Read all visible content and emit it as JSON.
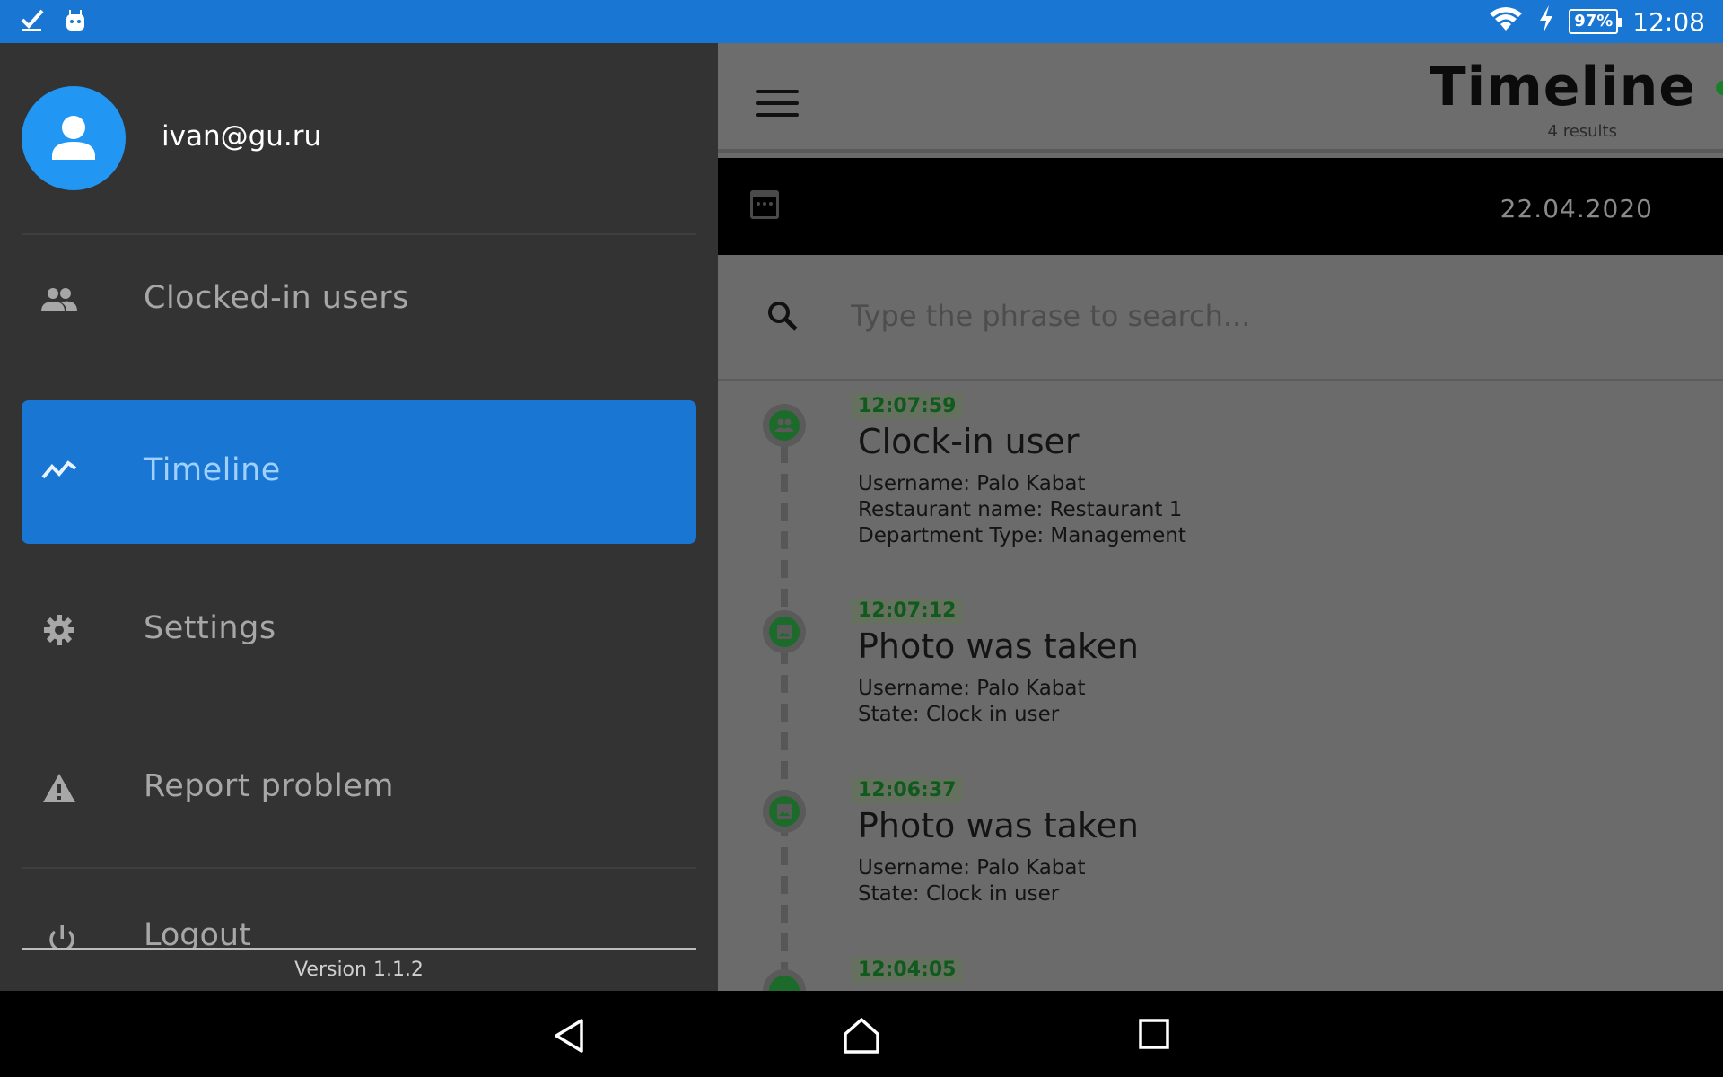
{
  "status_bar": {
    "battery": "97%",
    "time": "12:08",
    "icons": [
      "check-notification-icon",
      "android-notification-icon",
      "wifi-icon",
      "charging-icon",
      "battery-icon"
    ]
  },
  "drawer": {
    "user_email": "ivan@gu.ru",
    "items": [
      {
        "label": "Clocked-in users",
        "icon": "people-icon"
      },
      {
        "label": "Timeline",
        "icon": "trend-icon",
        "active": true
      },
      {
        "label": "Settings",
        "icon": "gear-icon"
      },
      {
        "label": "Report problem",
        "icon": "warning-icon"
      },
      {
        "label": "Logout",
        "icon": "power-icon"
      }
    ],
    "version": "Version 1.1.2"
  },
  "header": {
    "title": "Timeline",
    "subtitle": "4 results"
  },
  "date_bar": {
    "date": "22.04.2020"
  },
  "search": {
    "placeholder": "Type the phrase to search..."
  },
  "timeline": [
    {
      "time": "12:07:59",
      "title": "Clock-in user",
      "icon": "people-icon",
      "lines": [
        "Username: Palo Kabat",
        "Restaurant name: Restaurant 1",
        "Department Type: Management"
      ]
    },
    {
      "time": "12:07:12",
      "title": "Photo was taken",
      "icon": "image-icon",
      "lines": [
        "Username: Palo Kabat",
        "State: Clock in user"
      ]
    },
    {
      "time": "12:06:37",
      "title": "Photo was taken",
      "icon": "image-icon",
      "lines": [
        "Username: Palo Kabat",
        "State: Clock in user"
      ]
    },
    {
      "time": "12:04:05",
      "title": "",
      "icon": "people-icon",
      "lines": []
    }
  ],
  "colors": {
    "status_bar": "#1976d2",
    "drawer_bg": "#333333",
    "active_item": "#1976d2",
    "avatar": "#2196f3",
    "timeline_green": "#1d6b2a"
  }
}
